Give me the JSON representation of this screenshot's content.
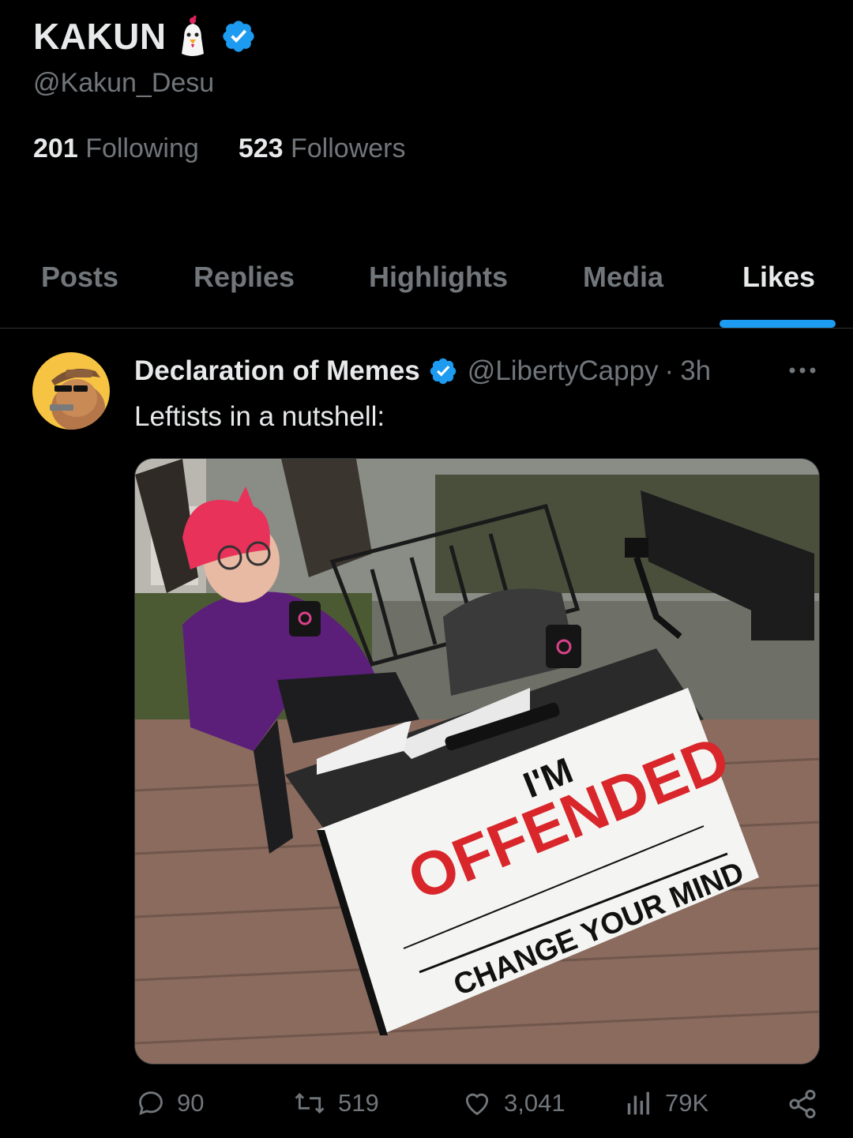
{
  "profile": {
    "display_name": "KAKUN",
    "handle": "@Kakun_Desu",
    "following_count": "201",
    "following_label": "Following",
    "followers_count": "523",
    "followers_label": "Followers"
  },
  "tabs": [
    {
      "label": "Posts"
    },
    {
      "label": "Replies"
    },
    {
      "label": "Highlights"
    },
    {
      "label": "Media"
    },
    {
      "label": "Likes",
      "active": true
    }
  ],
  "tweet": {
    "author": "Declaration of Memes",
    "handle": "@LibertyCappy",
    "separator": "·",
    "time": "3h",
    "text": "Leftists in a nutshell:",
    "image_text": {
      "line1": "I'M",
      "line2": "OFFENDED",
      "line3": "CHANGE YOUR MIND"
    },
    "stats": {
      "replies": "90",
      "reposts": "519",
      "likes": "3,041",
      "views": "79K"
    }
  },
  "colors": {
    "accent": "#1d9bf0",
    "background": "#000000",
    "muted_text": "#71767b",
    "primary_text": "#e7e9ea"
  }
}
